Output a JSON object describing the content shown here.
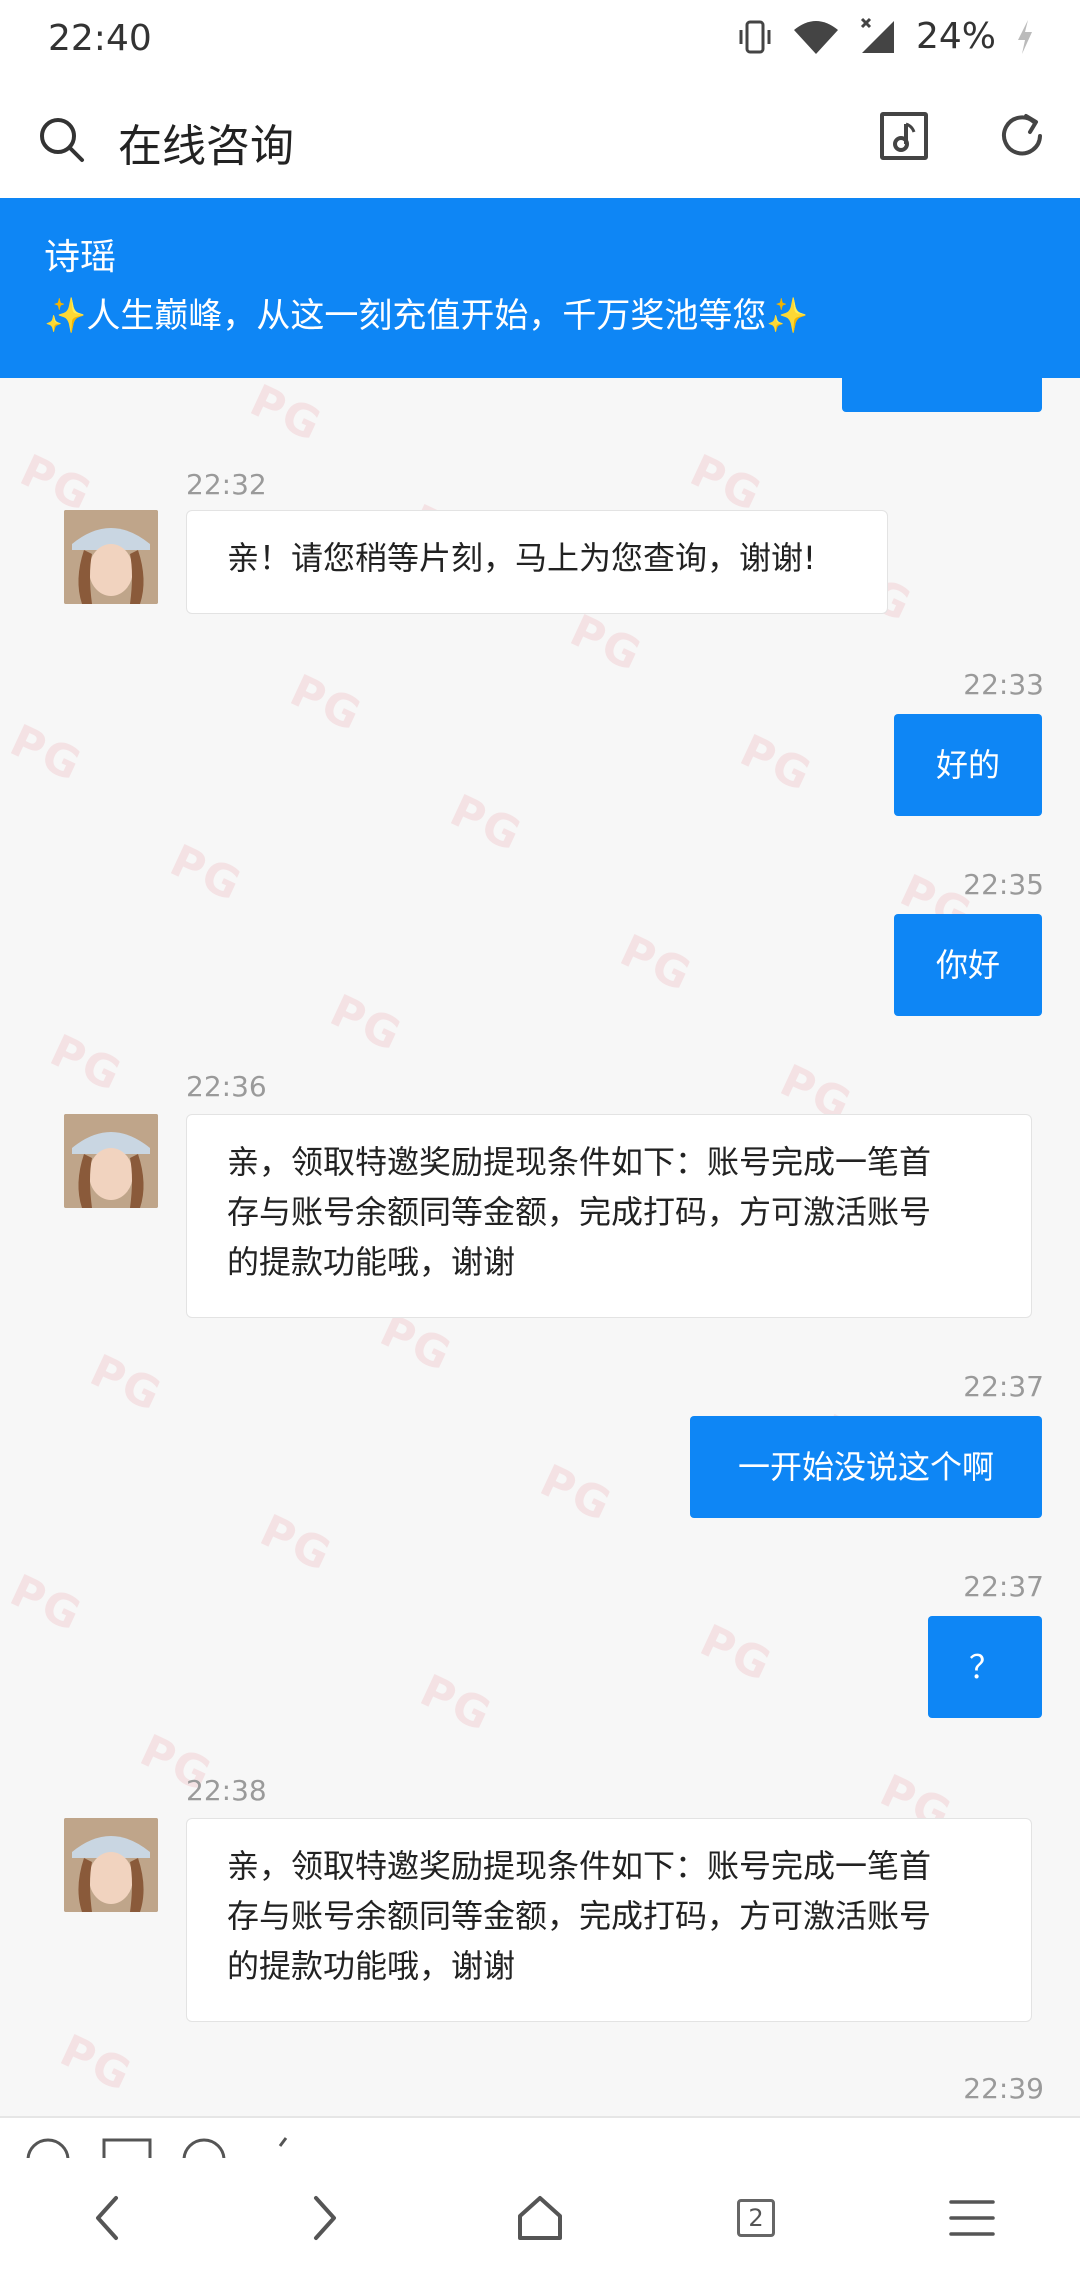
{
  "status_bar": {
    "time": "22:40",
    "battery": "24%",
    "icons": [
      "vibrate-icon",
      "wifi-icon",
      "signal-icon",
      "charging-icon"
    ]
  },
  "header": {
    "title": "在线咨询",
    "icons": [
      "search-icon",
      "music-icon",
      "refresh-icon"
    ]
  },
  "banner": {
    "name": "诗瑶",
    "text": "人生巅峰，从这一刻充值开始，千万奖池等您",
    "sparkle": "✨",
    "background": "#0e86f5"
  },
  "watermark": "PG",
  "messages": [
    {
      "side": "agent",
      "time": "22:32",
      "text": "亲！请您稍等片刻，马上为您查询，谢谢!"
    },
    {
      "side": "user",
      "time": "22:33",
      "text": "好的"
    },
    {
      "side": "user",
      "time": "22:35",
      "text": "你好"
    },
    {
      "side": "agent",
      "time": "22:36",
      "lines": [
        "亲，领取特邀奖励提现条件如下：账号完成一笔首",
        "存与账号余额同等金额，完成打码，方可激活账号",
        "的提款功能哦，谢谢"
      ]
    },
    {
      "side": "user",
      "time": "22:37",
      "text": "一开始没说这个啊"
    },
    {
      "side": "user",
      "time": "22:37",
      "text": "？"
    },
    {
      "side": "agent",
      "time": "22:38",
      "lines": [
        "亲，领取特邀奖励提现条件如下：账号完成一笔首",
        "存与账号余额同等金额，完成打码，方可激活账号",
        "的提款功能哦，谢谢"
      ]
    },
    {
      "side": "user",
      "time": "22:39"
    }
  ],
  "nav": {
    "tab_count": "2",
    "icons": [
      "back-icon",
      "forward-icon",
      "home-icon",
      "tabs-icon",
      "menu-icon"
    ]
  },
  "colors": {
    "accent": "#0e86f5",
    "background": "#f7f7f7",
    "timestamp": "#9a9a9a"
  }
}
